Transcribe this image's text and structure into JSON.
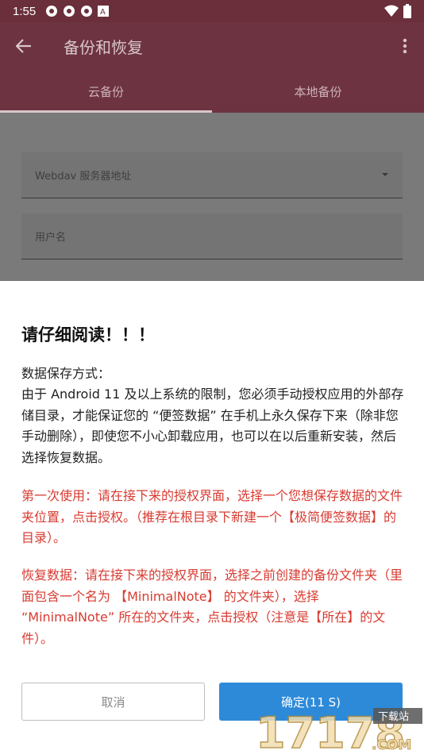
{
  "status_bar": {
    "time": "1:55"
  },
  "app_bar": {
    "title": "备份和恢复"
  },
  "tabs": [
    {
      "label": "云备份",
      "active": true
    },
    {
      "label": "本地备份",
      "active": false
    }
  ],
  "form": {
    "server_field": "Webdav 服务器地址",
    "username_field": "用户名"
  },
  "dialog": {
    "title": "请仔细阅读！！！",
    "paragraph1_heading": "数据保存方式：",
    "paragraph1": "由于 Android 11 及以上系统的限制，您必须手动授权应用的外部存储目录，才能保证您的 “便签数据” 在手机上永久保存下来（除非您手动删除），即使您不小心卸载应用，也可以在以后重新安装，然后选择恢复数据。",
    "paragraph2": "第一次使用：请在接下来的授权界面，选择一个您想保存数据的文件夹位置，点击授权。（推荐在根目录下新建一个【极简便签数据】的目录）。",
    "paragraph3": "恢复数据：请在接下来的授权界面，选择之前创建的备份文件夹（里面包含一个名为 【MinimalNote】 的文件夹），选择 “MinimalNote” 所在的文件夹，点击授权（注意是【所在】的文件）。",
    "cancel_label": "取消",
    "ok_label": "确定(11 S)"
  },
  "watermark": {
    "text": "17178",
    "sub": "下载站",
    "domain": ".COM"
  }
}
